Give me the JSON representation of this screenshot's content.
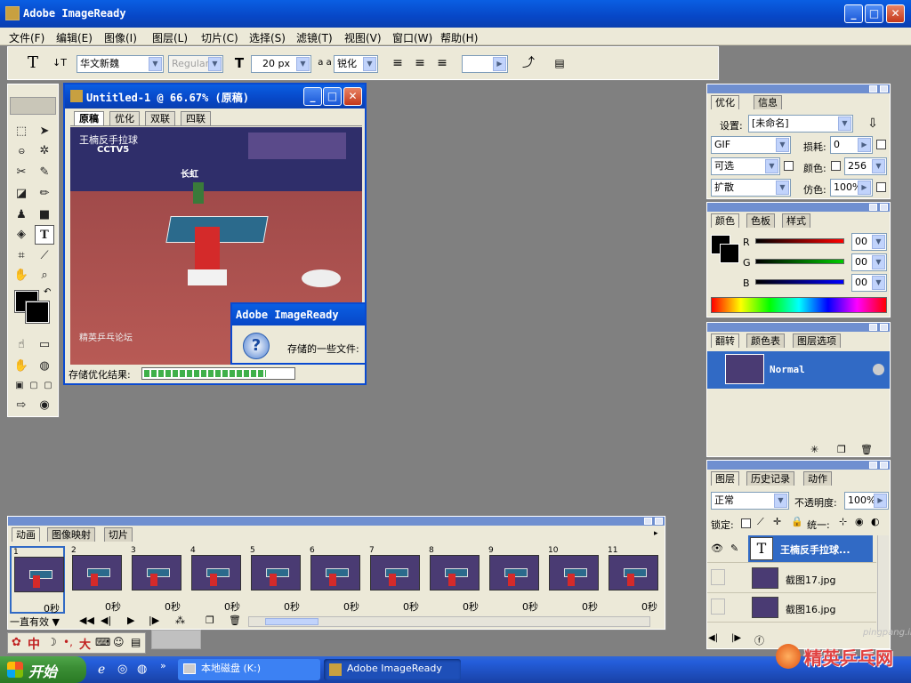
{
  "app": {
    "title": "Adobe ImageReady"
  },
  "menu": [
    "文件(F)",
    "编辑(E)",
    "图像(I)",
    "图层(L)",
    "切片(C)",
    "选择(S)",
    "滤镜(T)",
    "视图(V)",
    "窗口(W)",
    "帮助(H)"
  ],
  "options": {
    "font_family": "华文新魏",
    "font_style": "Regular",
    "font_size": "20 px",
    "aa_label": "a a",
    "antialias": "锐化"
  },
  "document": {
    "title": "Untitled-1 @ 66.67% (原稿)",
    "tabs": [
      "原稿",
      "优化",
      "双联",
      "四联"
    ],
    "status_label": "存储优化结果:",
    "progress": 0.82,
    "canvas": {
      "caption": "王楠反手拉球",
      "broadcaster": "CCTV5",
      "sponsor": "长虹",
      "watermark": "精英乒乓论坛"
    }
  },
  "dialog": {
    "title": "Adobe ImageReady",
    "message": "存储的一些文件:"
  },
  "optimize_panel": {
    "tabs": [
      "优化",
      "信息"
    ],
    "settings_label": "设置:",
    "settings_value": "[未命名]",
    "format": "GIF",
    "lossy_label": "损耗:",
    "lossy_value": "0",
    "reduction": "可选",
    "colors_label": "颜色:",
    "colors_value": "256",
    "dither_method": "扩散",
    "dither_label": "仿色:",
    "dither_value": "100%"
  },
  "color_panel": {
    "tabs": [
      "颜色",
      "色板",
      "样式"
    ],
    "channels": [
      {
        "name": "R",
        "value": "00"
      },
      {
        "name": "G",
        "value": "00"
      },
      {
        "name": "B",
        "value": "00"
      }
    ]
  },
  "rollover_panel": {
    "tabs": [
      "翻转",
      "颜色表",
      "图层选项"
    ],
    "state": "Normal"
  },
  "layers_panel": {
    "tabs": [
      "图层",
      "历史记录",
      "动作"
    ],
    "blend_mode": "正常",
    "opacity_label": "不透明度:",
    "opacity_value": "100%",
    "lock_label": "锁定:",
    "unify_label": "统一:",
    "layers": [
      {
        "name": "王楠反手拉球...",
        "type": "text"
      },
      {
        "name": "截图17.jpg",
        "type": "image"
      },
      {
        "name": "截图16.jpg",
        "type": "image"
      }
    ]
  },
  "animation_panel": {
    "tabs": [
      "动画",
      "图像映射",
      "切片"
    ],
    "loop": "一直有效",
    "frames": [
      {
        "num": "1",
        "delay": "0秒"
      },
      {
        "num": "2",
        "delay": "0秒"
      },
      {
        "num": "3",
        "delay": "0秒"
      },
      {
        "num": "4",
        "delay": "0秒"
      },
      {
        "num": "5",
        "delay": "0秒"
      },
      {
        "num": "6",
        "delay": "0秒"
      },
      {
        "num": "7",
        "delay": "0秒"
      },
      {
        "num": "8",
        "delay": "0秒"
      },
      {
        "num": "9",
        "delay": "0秒"
      },
      {
        "num": "10",
        "delay": "0秒"
      },
      {
        "num": "11",
        "delay": "0秒"
      }
    ]
  },
  "ime_bar": {
    "label": "中"
  },
  "taskbar": {
    "start": "开始",
    "items": [
      "本地磁盘 (K:)",
      "Adobe ImageReady"
    ]
  },
  "watermark": {
    "site": "pingpang.info",
    "logo_text": "精英乒乓网"
  },
  "colors": {
    "title_blue": "#0a52d8",
    "panel_bg": "#ece9d8",
    "selected_blue": "#316ac5",
    "taskbar_blue": "#245edb",
    "start_green": "#3c8f36"
  }
}
